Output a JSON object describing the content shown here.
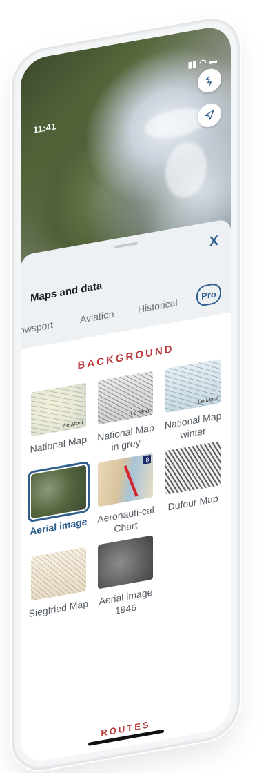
{
  "status_bar": {
    "time": "11:41"
  },
  "map": {
    "buttons": [
      "layers-icon",
      "location-arrow-icon"
    ]
  },
  "sheet": {
    "title": "Maps and data",
    "close_label": "X",
    "tabs": [
      "owsport",
      "Aviation",
      "Historical"
    ],
    "pro_label": "Pro",
    "section_title": "BACKGROUND",
    "layers": [
      {
        "label": "National Map",
        "selected": false
      },
      {
        "label": "National Map in grey",
        "selected": false
      },
      {
        "label": "National Map winter",
        "selected": false
      },
      {
        "label": "Aerial image",
        "selected": true
      },
      {
        "label": "Aeronauti-cal Chart",
        "selected": false
      },
      {
        "label": "Dufour Map",
        "selected": false
      },
      {
        "label": "Siegfried Map",
        "selected": false
      },
      {
        "label": "Aerial image 1946",
        "selected": false
      }
    ],
    "next_section": "ROUTES"
  },
  "thumb_marks": {
    "national": "Le Mont",
    "aero_badge": "8"
  },
  "colors": {
    "accent": "#2f5d8c",
    "section": "#b83a3a"
  }
}
